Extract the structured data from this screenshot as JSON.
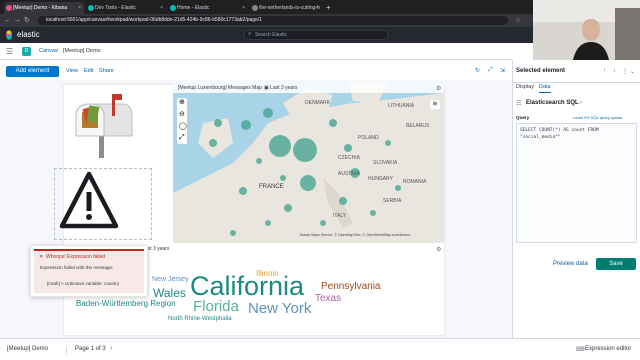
{
  "browser": {
    "tabs": [
      {
        "label": "[Meetup] Demo - Kibana",
        "color": "#f04e98"
      },
      {
        "label": "Dev Tools - Elastic",
        "color": "#00bfb3"
      },
      {
        "label": "Home - Elastic",
        "color": "#00bfb3"
      },
      {
        "label": "the-netherlands-is-cutting-h",
        "color": "#888888"
      }
    ],
    "url": "localhost:5601/app/canvas#/workpad/workpad-06db8dde-21d5-424b-9c86-b580c1773ab2/page/1"
  },
  "header": {
    "app_name": "elastic",
    "search_placeholder": "Search Elastic",
    "user": "milos.mandic@elasti..."
  },
  "breadcrumb": {
    "canvas": "Canvas",
    "workpad": "[Meetup] Demo"
  },
  "toolbar": {
    "add_element": "Add element",
    "view": "View",
    "edit": "Edit",
    "share": "Share"
  },
  "map": {
    "title": "[Meetup Luxembourg] Messages Map",
    "time": "Last 3 years",
    "attribution": "Elastic Maps Service, © OpenMapTiles, © OpenStreetMap contributors",
    "countries": [
      {
        "name": "DENMARK"
      },
      {
        "name": "LITHUANIA"
      },
      {
        "name": "BELARUS"
      },
      {
        "name": "POLAND"
      },
      {
        "name": "CZECHIA"
      },
      {
        "name": "SLOVAKIA"
      },
      {
        "name": "FRANCE"
      },
      {
        "name": "AUSTRIA"
      },
      {
        "name": "HUNGARY"
      },
      {
        "name": "ROMANIA"
      },
      {
        "name": "SERBIA"
      },
      {
        "name": "ITALY"
      }
    ]
  },
  "second_panel_time": "Last 3 years",
  "error": {
    "title": "Whoops! Expression failed",
    "subtitle": "Expression failed with the message:",
    "message": "[math] > Unknown variable: country"
  },
  "wordcloud": [
    {
      "text": "California",
      "color": "#1c8a84"
    },
    {
      "text": "New York",
      "color": "#6092c0"
    },
    {
      "text": "Florida",
      "color": "#54b399"
    },
    {
      "text": "Wales",
      "color": "#1c8a84"
    },
    {
      "text": "Pennsylvania",
      "color": "#9c4b1c"
    },
    {
      "text": "Texas",
      "color": "#b05ba6"
    },
    {
      "text": "Illinois",
      "color": "#d6a541"
    },
    {
      "text": "New Jersey",
      "color": "#6092c0"
    },
    {
      "text": "Baden-Württemberg Region",
      "color": "#1c8a84"
    },
    {
      "text": "North Rhine-Westphalia",
      "color": "#1c8a84"
    }
  ],
  "panel": {
    "title": "Selected element",
    "tabs": [
      "Display",
      "Data"
    ],
    "datasource": "Elasticsearch SQL",
    "query_label": "Query",
    "query_link": "Learn ES SQL query syntax",
    "query": "SELECT COUNT(*) AS count FROM \"social_media*\"",
    "preview": "Preview data",
    "save": "Save"
  },
  "footer": {
    "workpad": "[Meetup] Demo",
    "page": "Page 1 of 3",
    "expression_editor": "Expression editor"
  }
}
